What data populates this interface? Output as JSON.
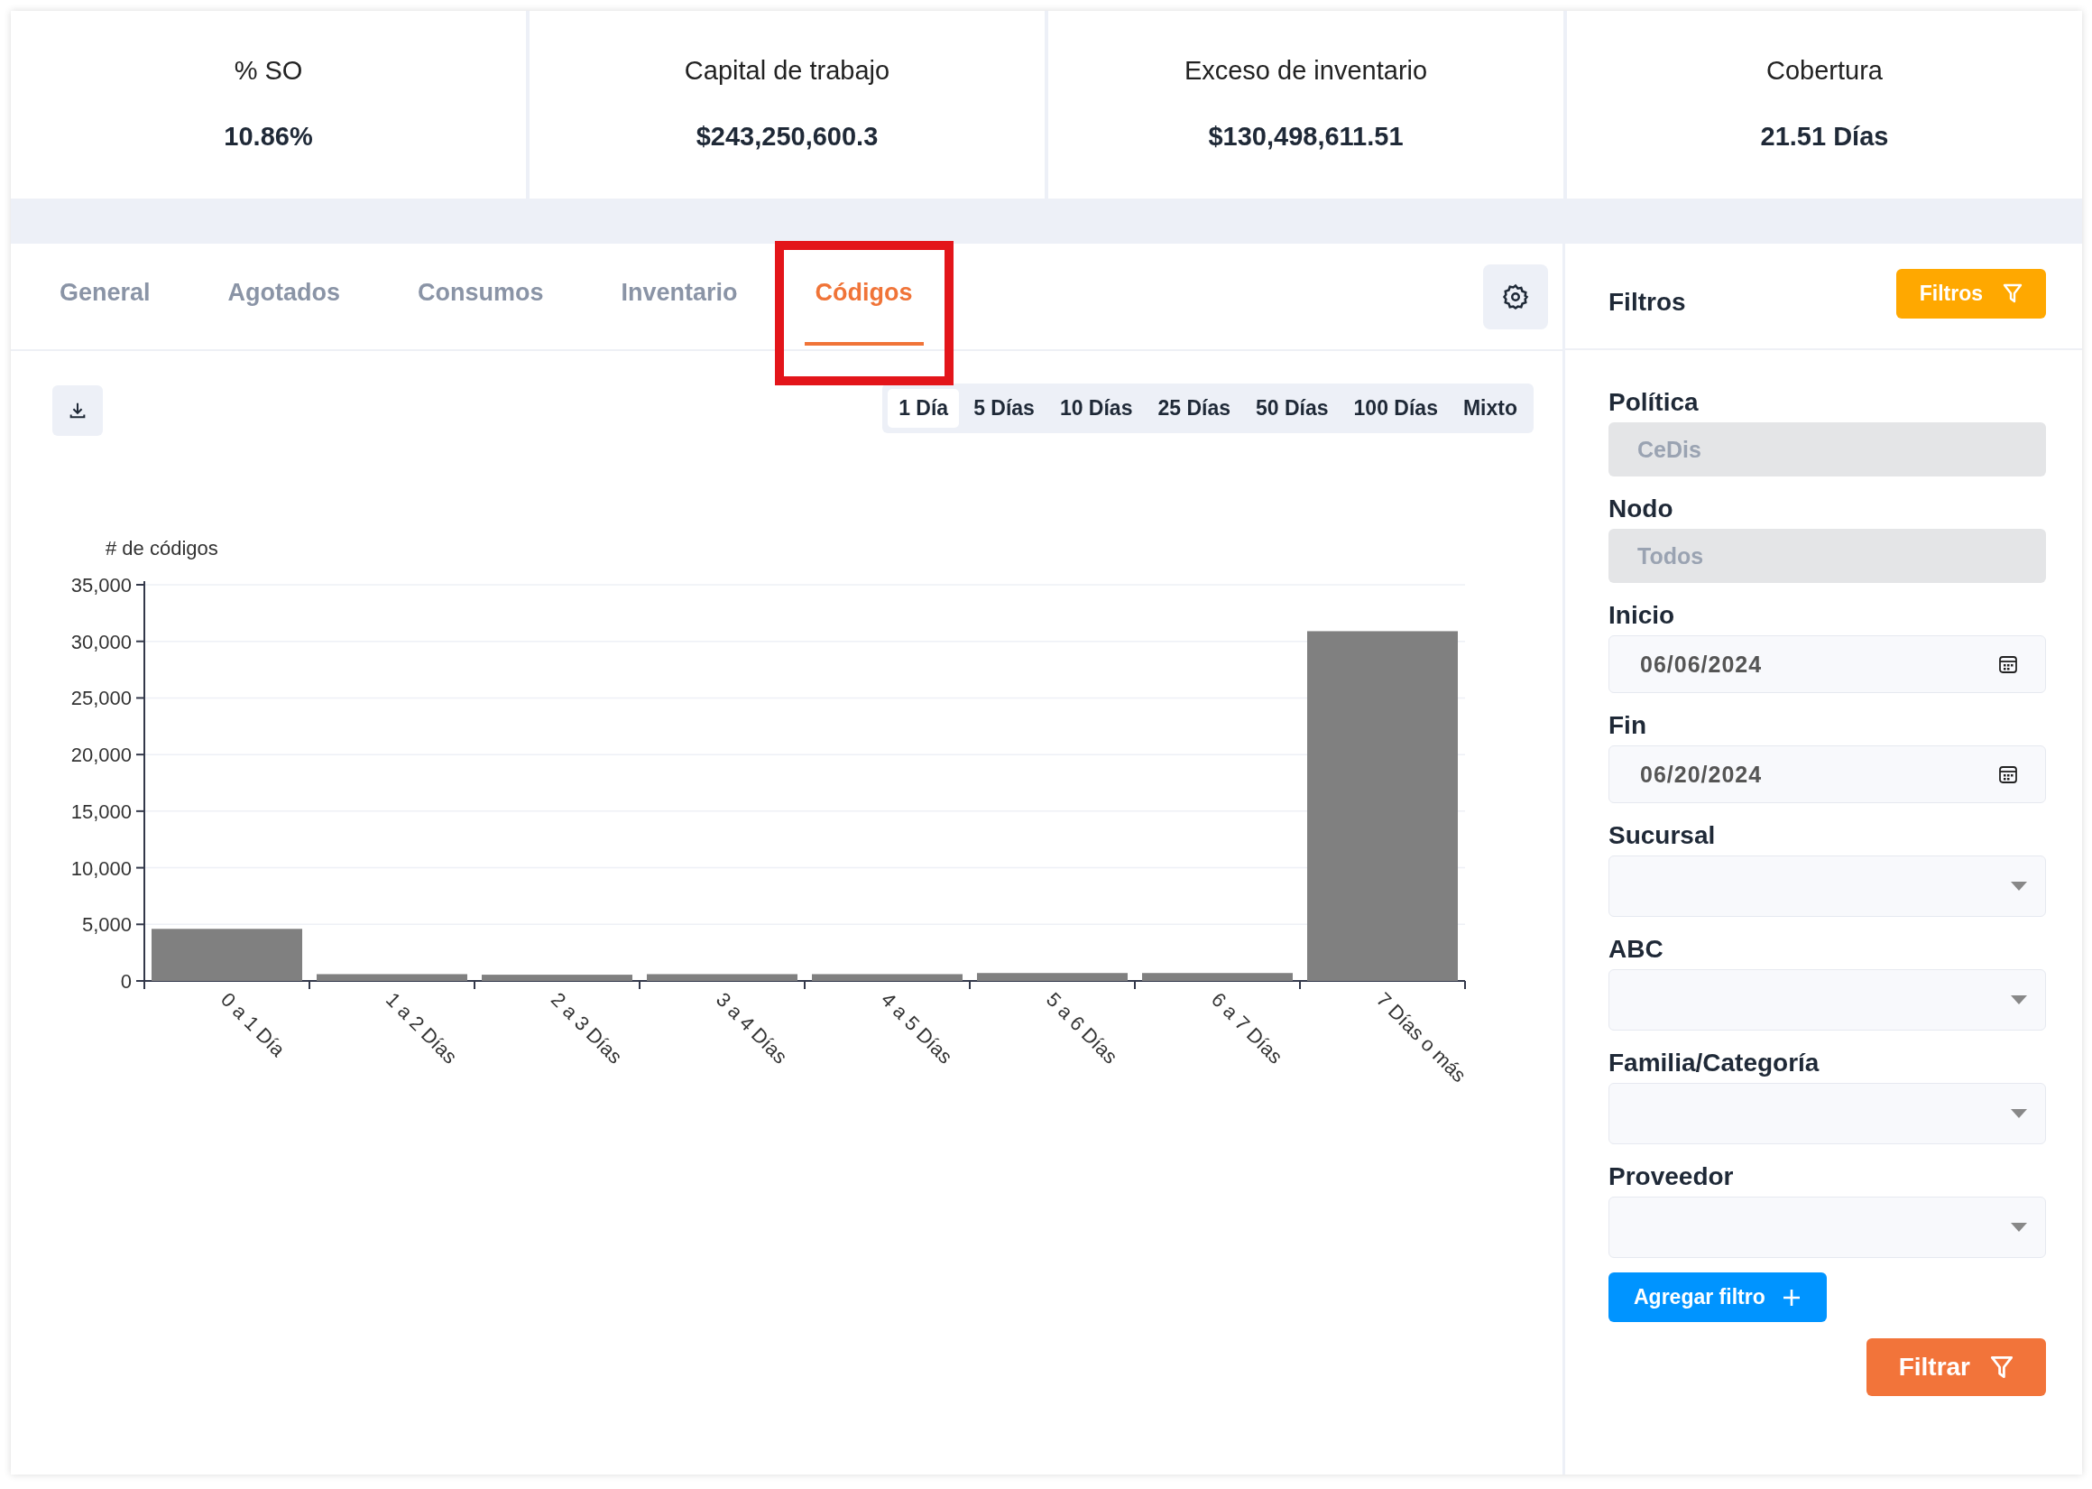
{
  "kpis": [
    {
      "title": "% SO",
      "value": "10.86%"
    },
    {
      "title": "Capital de trabajo",
      "value": "$243,250,600.3"
    },
    {
      "title": "Exceso de inventario",
      "value": "$130,498,611.51"
    },
    {
      "title": "Cobertura",
      "value": "21.51 Días"
    }
  ],
  "tabs": [
    {
      "label": "General",
      "selected": false,
      "highlighted": false
    },
    {
      "label": "Agotados",
      "selected": false,
      "highlighted": false
    },
    {
      "label": "Consumos",
      "selected": false,
      "highlighted": false
    },
    {
      "label": "Inventario",
      "selected": false,
      "highlighted": false
    },
    {
      "label": "Códigos",
      "selected": true,
      "highlighted": true
    }
  ],
  "ranges": [
    {
      "label": "1 Día",
      "selected": true
    },
    {
      "label": "5 Días",
      "selected": false
    },
    {
      "label": "10 Días",
      "selected": false
    },
    {
      "label": "25 Días",
      "selected": false
    },
    {
      "label": "50 Días",
      "selected": false
    },
    {
      "label": "100 Días",
      "selected": false
    },
    {
      "label": "Mixto",
      "selected": false
    }
  ],
  "chart": {
    "chart_data": {
      "type": "bar",
      "ylabel": "# de códigos",
      "categories": [
        "0 a 1 Día",
        "1 a 2 Días",
        "2 a 3 Días",
        "3 a 4 Días",
        "4 a 5 Días",
        "5 a 6 Días",
        "6 a 7 Días",
        "7 Días o más"
      ],
      "grid": true,
      "series": [
        {
          "color": "#808080",
          "values": [
            4600,
            600,
            550,
            600,
            600,
            700,
            700,
            30900
          ]
        }
      ],
      "ylim": [
        0,
        35000
      ],
      "yticks": [
        {
          "value": 0,
          "label": "0"
        },
        {
          "value": 5000,
          "label": "5,000"
        },
        {
          "value": 10000,
          "label": "10,000"
        },
        {
          "value": 15000,
          "label": "15,000"
        },
        {
          "value": 20000,
          "label": "20,000"
        },
        {
          "value": 25000,
          "label": "25,000"
        },
        {
          "value": 30000,
          "label": "30,000"
        },
        {
          "value": 35000,
          "label": "35,000"
        }
      ]
    }
  },
  "filters": {
    "title": "Filtros",
    "toggle_button": "Filtros",
    "fields": [
      {
        "label": "Política",
        "kind": "disabled",
        "value": "CeDis"
      },
      {
        "label": "Nodo",
        "kind": "disabled",
        "value": "Todos"
      },
      {
        "label": "Inicio",
        "kind": "date",
        "value": "06/06/2024"
      },
      {
        "label": "Fin",
        "kind": "date",
        "value": "06/20/2024"
      },
      {
        "label": "Sucursal",
        "kind": "select"
      },
      {
        "label": "ABC",
        "kind": "select"
      },
      {
        "label": "Familia/Categoría",
        "kind": "select"
      },
      {
        "label": "Proveedor",
        "kind": "select"
      }
    ],
    "add_button": "Agregar filtro",
    "submit_button": "Filtrar"
  }
}
